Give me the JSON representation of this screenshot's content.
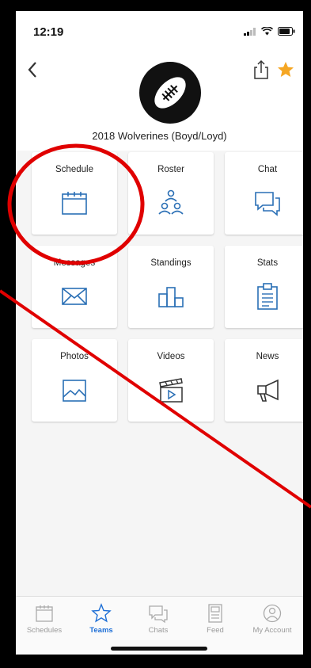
{
  "status_bar": {
    "time": "12:19"
  },
  "header": {
    "team_name": "2018 Wolverines (Boyd/Loyd)"
  },
  "tiles": [
    {
      "label": "Schedule"
    },
    {
      "label": "Roster"
    },
    {
      "label": "Chat"
    },
    {
      "label": "Messages"
    },
    {
      "label": "Standings"
    },
    {
      "label": "Stats"
    },
    {
      "label": "Photos"
    },
    {
      "label": "Videos"
    },
    {
      "label": "News"
    }
  ],
  "tabbar": {
    "items": [
      {
        "label": "Schedules"
      },
      {
        "label": "Teams"
      },
      {
        "label": "Chats"
      },
      {
        "label": "Feed"
      },
      {
        "label": "My Account"
      }
    ],
    "active": "Teams"
  },
  "colors": {
    "accent_blue": "#1e6fd6",
    "icon_blue": "#2a6fb5",
    "star": "#f5a623",
    "annotation_red": "#e00000"
  },
  "icons": [
    "back-chevron-icon",
    "share-icon",
    "star-icon",
    "football-logo",
    "calendar-icon",
    "people-icon",
    "chat-bubbles-icon",
    "envelope-icon",
    "podium-icon",
    "clipboard-icon",
    "photo-icon",
    "clapperboard-icon",
    "megaphone-icon"
  ]
}
